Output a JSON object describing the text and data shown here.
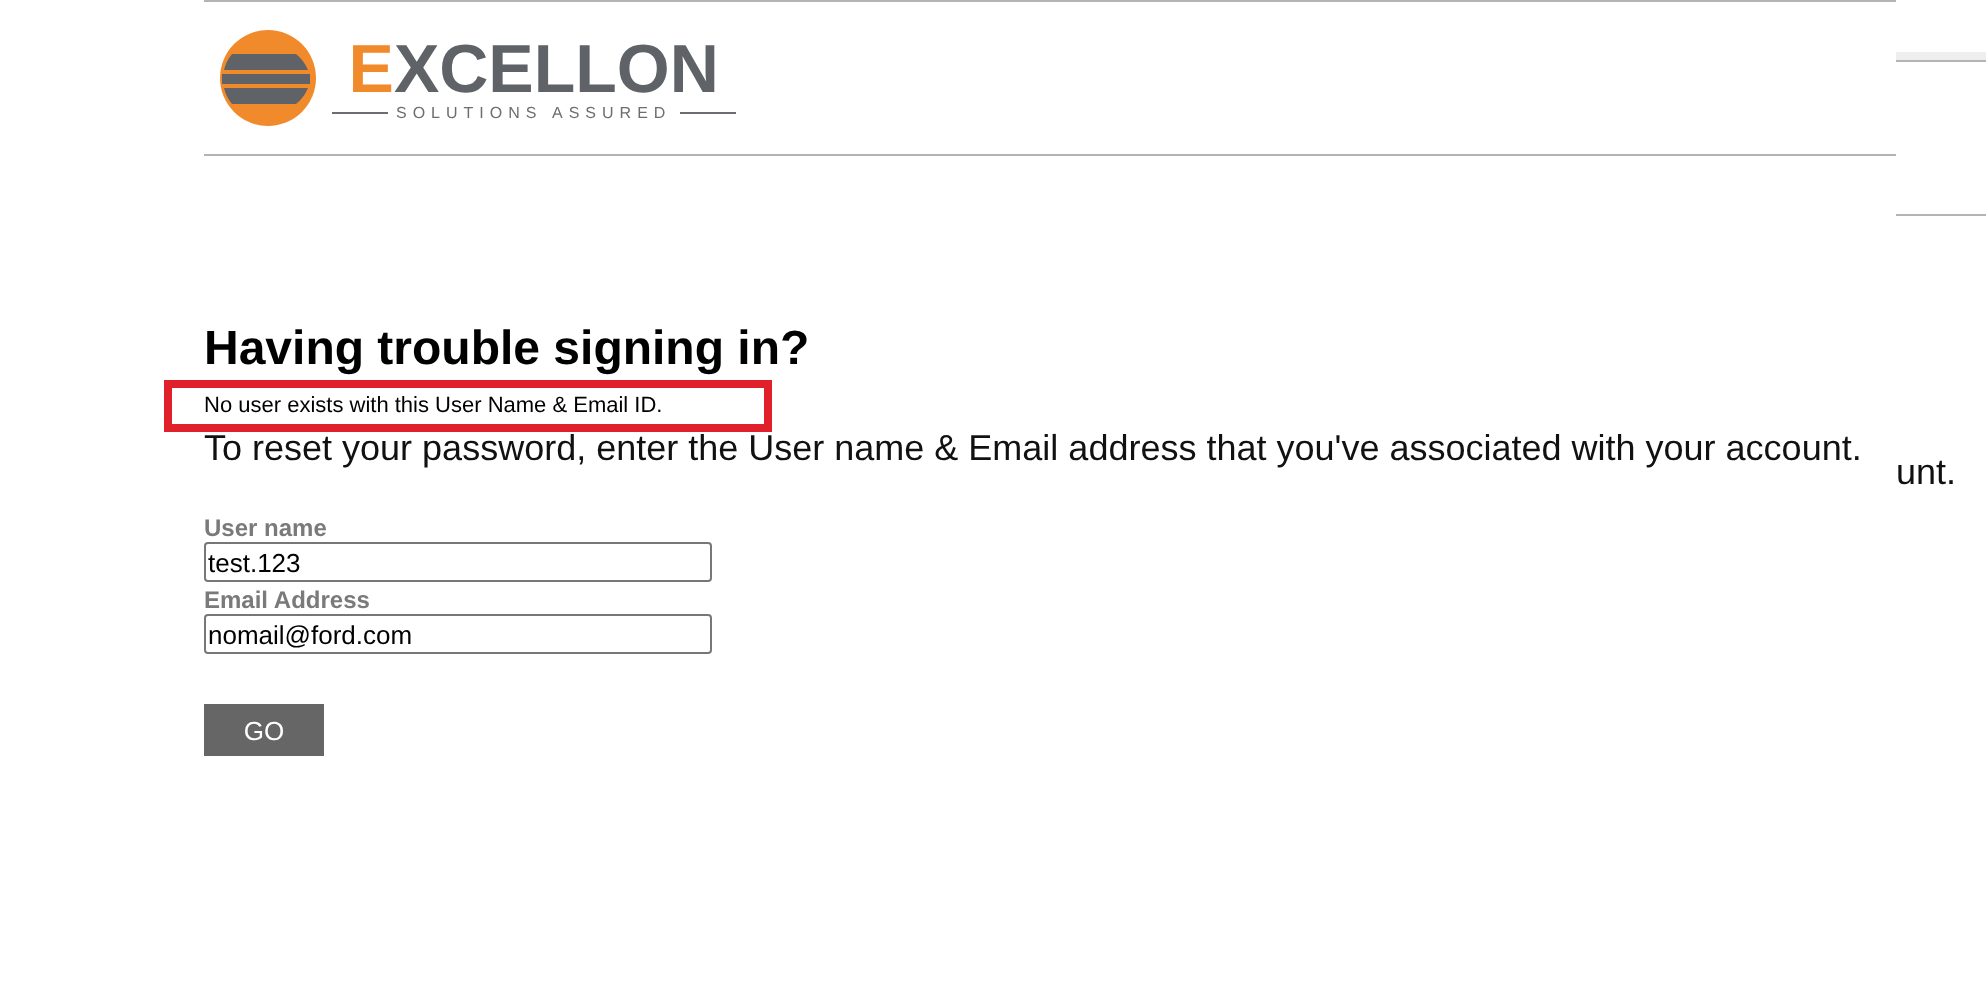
{
  "logo": {
    "wordmark": "EXCELLON",
    "tagline": "SOLUTIONS ASSURED"
  },
  "heading": "Having trouble signing in?",
  "error_message": {
    "text": "No user exists with this User Name & Email ID.",
    "highlighted": true
  },
  "instructions": "To reset your password, enter the User name & Email address that you've associated with your account.",
  "overlap_fragment": "unt.",
  "fields": [
    {
      "label": "User name",
      "value": "test.123"
    },
    {
      "label": "Email Address",
      "value": "nomail@ford.com"
    }
  ],
  "button": "GO"
}
